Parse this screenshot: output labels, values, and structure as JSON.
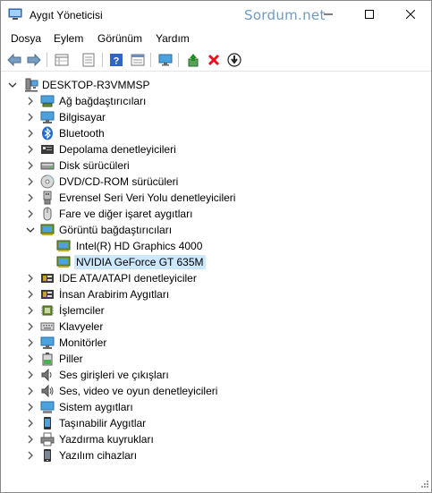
{
  "window": {
    "title": "Aygıt Yöneticisi",
    "watermark": "Sordum.net"
  },
  "menu": [
    "Dosya",
    "Eylem",
    "Görünüm",
    "Yardım"
  ],
  "toolbar": {
    "icons": [
      "back-icon",
      "forward-icon",
      "properties-grid-icon",
      "device-sheet-icon",
      "help-icon",
      "console-icon",
      "monitor-icon",
      "update-driver-icon",
      "uninstall-icon",
      "download-icon"
    ]
  },
  "tree": {
    "root": "DESKTOP-R3VMMSP",
    "categories": [
      {
        "label": "Ağ bağdaştırıcıları",
        "icon": "network-adapter-icon",
        "expanded": false
      },
      {
        "label": "Bilgisayar",
        "icon": "computer-icon",
        "expanded": false
      },
      {
        "label": "Bluetooth",
        "icon": "bluetooth-icon",
        "expanded": false
      },
      {
        "label": "Depolama denetleyicileri",
        "icon": "storage-controller-icon",
        "expanded": false
      },
      {
        "label": "Disk sürücüleri",
        "icon": "disk-drive-icon",
        "expanded": false
      },
      {
        "label": "DVD/CD-ROM sürücüleri",
        "icon": "dvd-icon",
        "expanded": false
      },
      {
        "label": "Evrensel Seri Veri Yolu denetleyicileri",
        "icon": "usb-icon",
        "expanded": false
      },
      {
        "label": "Fare ve diğer işaret aygıtları",
        "icon": "mouse-icon",
        "expanded": false
      },
      {
        "label": "Görüntü bağdaştırıcıları",
        "icon": "display-adapter-icon",
        "expanded": true,
        "children": [
          {
            "label": "Intel(R) HD Graphics 4000",
            "selected": false
          },
          {
            "label": "NVIDIA GeForce GT 635M",
            "selected": true
          }
        ]
      },
      {
        "label": "IDE ATA/ATAPI denetleyiciler",
        "icon": "ide-icon",
        "expanded": false
      },
      {
        "label": "İnsan Arabirim Aygıtları",
        "icon": "hid-icon",
        "expanded": false
      },
      {
        "label": "İşlemciler",
        "icon": "processor-icon",
        "expanded": false
      },
      {
        "label": "Klavyeler",
        "icon": "keyboard-icon",
        "expanded": false
      },
      {
        "label": "Monitörler",
        "icon": "monitor-icon",
        "expanded": false
      },
      {
        "label": "Piller",
        "icon": "battery-icon",
        "expanded": false
      },
      {
        "label": "Ses girişleri ve çıkışları",
        "icon": "audio-io-icon",
        "expanded": false
      },
      {
        "label": "Ses, video ve oyun denetleyicileri",
        "icon": "sound-controller-icon",
        "expanded": false
      },
      {
        "label": "Sistem aygıtları",
        "icon": "system-device-icon",
        "expanded": false
      },
      {
        "label": "Taşınabilir Aygıtlar",
        "icon": "portable-device-icon",
        "expanded": false
      },
      {
        "label": "Yazdırma kuyrukları",
        "icon": "print-queue-icon",
        "expanded": false
      },
      {
        "label": "Yazılım cihazları",
        "icon": "software-device-icon",
        "expanded": false
      }
    ]
  },
  "colors": {
    "selection": "#cce8ff",
    "watermark": "#6f9bc3",
    "accent_red": "#e81123"
  }
}
